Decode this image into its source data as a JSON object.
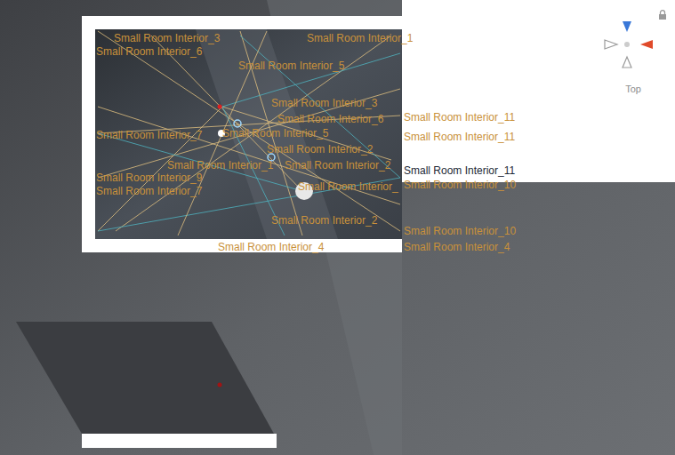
{
  "scene_view": {
    "orientation_label": "Top",
    "locked": true
  },
  "labels": [
    {
      "text": "Small Room Interior_3",
      "color": "#c9913a"
    },
    {
      "text": "Small Room Interior_1",
      "color": "#c9913a"
    },
    {
      "text": "Small Room Interior_6",
      "color": "#c9913a"
    },
    {
      "text": "Small Room Interior_5",
      "color": "#c9913a"
    },
    {
      "text": "Small Room Interior_3",
      "color": "#c9913a"
    },
    {
      "text": "Small Room Interior_11",
      "color": "#c9913a"
    },
    {
      "text": "Small Room Interior_6",
      "color": "#c9913a"
    },
    {
      "text": "Small Room Interior_7",
      "color": "#c9913a"
    },
    {
      "text": "Small Room Interior_5",
      "color": "#c9913a"
    },
    {
      "text": "Small Room Interior_11",
      "color": "#c9913a"
    },
    {
      "text": "Small Room Interior_2",
      "color": "#c9913a"
    },
    {
      "text": "Small Room Interior_1",
      "color": "#c9913a"
    },
    {
      "text": "Small Room Interior_2",
      "color": "#c9913a"
    },
    {
      "text": "Small Room Interior_11",
      "color": "#1c2836"
    },
    {
      "text": "Small Room Interior_9",
      "color": "#c9913a"
    },
    {
      "text": "Small Room Interior_",
      "color": "#c9913a"
    },
    {
      "text": "Small Room Interior_10",
      "color": "#c9913a"
    },
    {
      "text": "Small Room Interior_7",
      "color": "#c9913a"
    },
    {
      "text": "Small Room Interior_2",
      "color": "#c9913a"
    },
    {
      "text": "Small Room Interior_10",
      "color": "#c9913a"
    },
    {
      "text": "Small Room Interior_4",
      "color": "#c9913a"
    },
    {
      "text": "Small Room Interior_4",
      "color": "#c9913a"
    }
  ]
}
